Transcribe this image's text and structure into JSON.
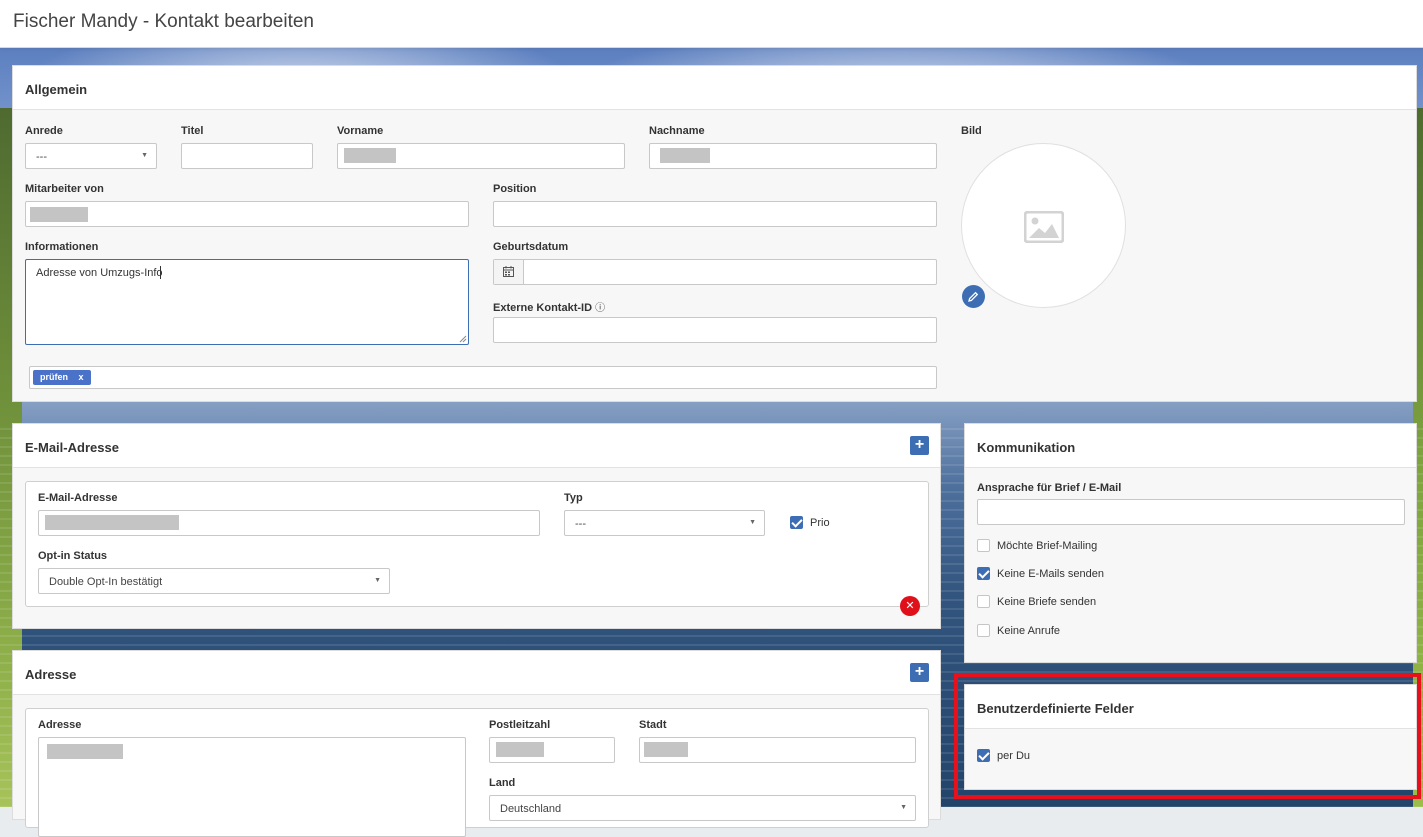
{
  "window": {
    "title": "Fischer Mandy - Kontakt bearbeiten"
  },
  "allgemein": {
    "title": "Allgemein",
    "anrede": {
      "label": "Anrede",
      "value": "---"
    },
    "titel": {
      "label": "Titel",
      "value": ""
    },
    "vorname": {
      "label": "Vorname"
    },
    "nachname": {
      "label": "Nachname"
    },
    "bild": {
      "label": "Bild",
      "icon": "image-icon",
      "edit_icon": "pencil-icon"
    },
    "mitarbeiter_von": {
      "label": "Mitarbeiter von"
    },
    "position": {
      "label": "Position",
      "value": ""
    },
    "informationen": {
      "label": "Informationen",
      "value": "Adresse von Umzugs-Info"
    },
    "geburtsdatum": {
      "label": "Geburtsdatum",
      "value": "",
      "icon": "calendar-icon"
    },
    "externe_id": {
      "label": "Externe Kontakt-ID",
      "info_icon": "ⓘ",
      "value": ""
    },
    "tag": {
      "text": "prüfen",
      "remove": "x"
    }
  },
  "email": {
    "title": "E-Mail-Adresse",
    "add_icon": "+",
    "address_label": "E-Mail-Adresse",
    "typ_label": "Typ",
    "typ_value": "---",
    "prio_label": "Prio",
    "prio_checked": true,
    "optin_label": "Opt-in Status",
    "optin_value": "Double Opt-In bestätigt",
    "remove_icon": "✕"
  },
  "adresse": {
    "title": "Adresse",
    "add_icon": "+",
    "adresse_label": "Adresse",
    "plz_label": "Postleitzahl",
    "stadt_label": "Stadt",
    "land_label": "Land",
    "land_value": "Deutschland"
  },
  "kommunikation": {
    "title": "Kommunikation",
    "ansprache_label": "Ansprache für Brief / E-Mail",
    "ansprache_value": "",
    "options": [
      {
        "label": "Möchte Brief-Mailing",
        "checked": false
      },
      {
        "label": "Keine E-Mails senden",
        "checked": true
      },
      {
        "label": "Keine Briefe senden",
        "checked": false
      },
      {
        "label": "Keine Anrufe",
        "checked": false
      }
    ]
  },
  "benutzerdefiniert": {
    "title": "Benutzerdefinierte Felder",
    "highlight_color": "#e8101a",
    "options": [
      {
        "label": "per Du",
        "checked": true
      }
    ]
  },
  "colors": {
    "accent": "#3d6eb4",
    "danger": "#e0101a"
  }
}
